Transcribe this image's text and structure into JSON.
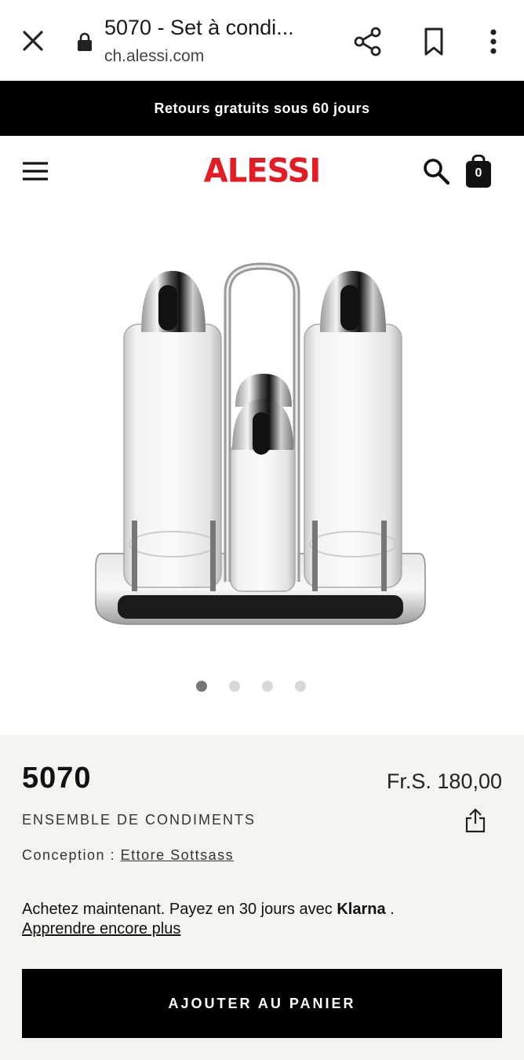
{
  "browser": {
    "tab_title": "5070 - Set à condi...",
    "url": "ch.alessi.com"
  },
  "promo": {
    "text": "Retours gratuits sous 60 jours"
  },
  "header": {
    "logo": "ALESSI",
    "cart_count": "0"
  },
  "gallery": {
    "image_subject": "condiment set",
    "dot_count": 4,
    "active_dot": 0
  },
  "product": {
    "name": "5070",
    "price": "Fr.S. 180,00",
    "subtitle": "ENSEMBLE DE CONDIMENTS",
    "design_label": "Conception :",
    "designer": "Ettore Sottsass"
  },
  "klarna": {
    "text_before": "Achetez maintenant. Payez en 30 jours avec ",
    "brand": "Klarna",
    "text_after": " .",
    "link": "Apprendre encore plus"
  },
  "actions": {
    "add_to_cart": "AJOUTER AU PANIER"
  },
  "colors": {
    "brand_red": "#e31b23",
    "banner_bg": "#000000",
    "panel_bg": "#f4f4f1"
  }
}
